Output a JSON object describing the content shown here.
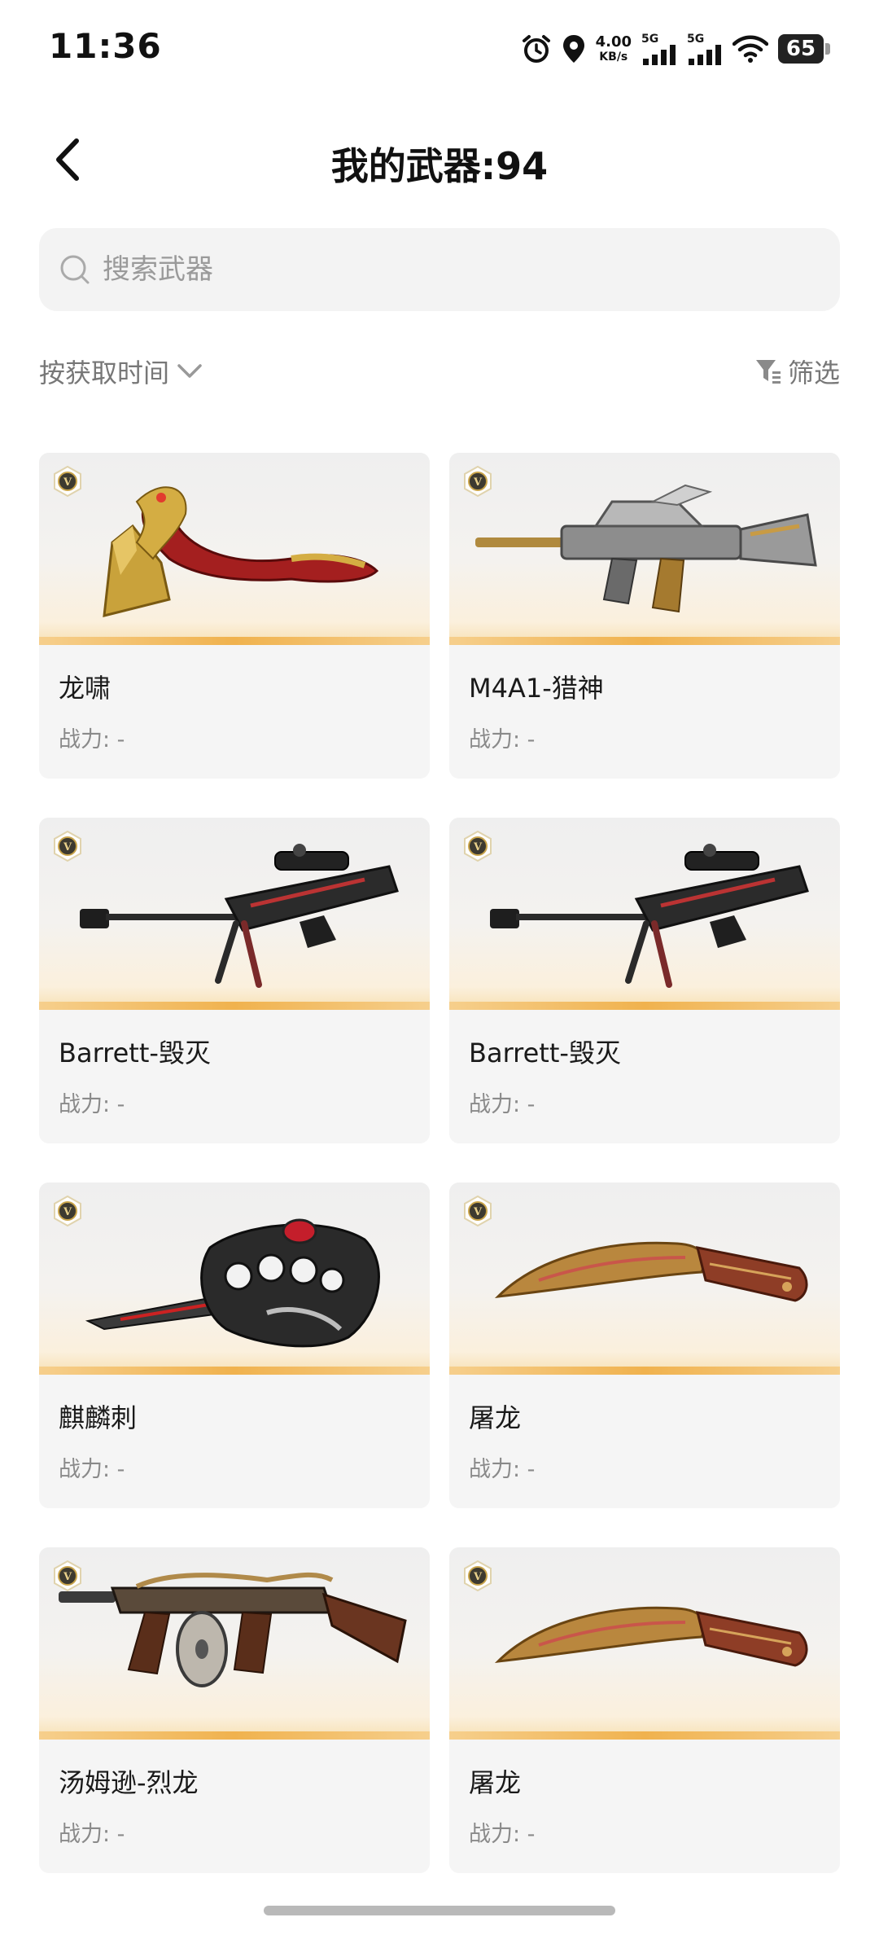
{
  "status_bar": {
    "time": "11:36",
    "net_speed_value": "4.00",
    "net_speed_unit": "KB/s",
    "sim1_label": "5G",
    "sim2_label": "5G",
    "battery_level": "65"
  },
  "header": {
    "title": "我的武器:94",
    "back_icon": "chevron-left-icon"
  },
  "search": {
    "placeholder": "搜索武器",
    "value": ""
  },
  "sort": {
    "label": "按获取时间"
  },
  "filter": {
    "label": "筛选"
  },
  "weapons": [
    {
      "name": "龙啸",
      "power": "战力: -",
      "icon": "axe-icon"
    },
    {
      "name": "M4A1-猎神",
      "power": "战力: -",
      "icon": "rifle-icon"
    },
    {
      "name": "Barrett-毁灭",
      "power": "战力: -",
      "icon": "sniper-rifle-icon"
    },
    {
      "name": "Barrett-毁灭",
      "power": "战力: -",
      "icon": "sniper-rifle-icon"
    },
    {
      "name": "麒麟刺",
      "power": "战力: -",
      "icon": "knuckle-blade-icon"
    },
    {
      "name": "屠龙",
      "power": "战力: -",
      "icon": "kukri-knife-icon"
    },
    {
      "name": "汤姆逊-烈龙",
      "power": "战力: -",
      "icon": "tommy-gun-icon"
    },
    {
      "name": "屠龙",
      "power": "战力: -",
      "icon": "kukri-knife-icon"
    }
  ],
  "colors": {
    "accent_bar": "#f0b24e",
    "card_bg": "#f5f5f5",
    "badge_gold": "#c9a44a"
  }
}
